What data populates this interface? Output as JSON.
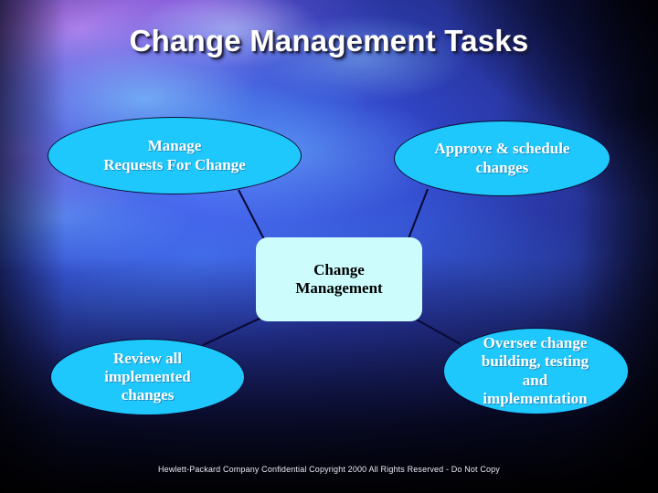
{
  "slide": {
    "title": "Change Management Tasks",
    "footer": "Hewlett-Packard Company Confidential Copyright 2000 All Rights Reserved - Do Not Copy",
    "background_colors": {
      "deep_navy": "#151a55",
      "purple": "#9660e2",
      "blue": "#3348cf",
      "cyan_glow": "#78cdff",
      "dark_edge": "#05030f"
    }
  },
  "diagram": {
    "type": "hub-and-spoke",
    "center": {
      "label": "Change\nManagement",
      "shape": "rounded-rectangle",
      "fill": "#ccfcfc",
      "text_color": "#000000"
    },
    "nodes": [
      {
        "id": "manage-requests",
        "label": "Manage\nRequests For Change",
        "shape": "ellipse",
        "fill": "#1ec8fc",
        "text_color": "#ffffff",
        "position": "top-left"
      },
      {
        "id": "approve-schedule",
        "label": "Approve & schedule\nchanges",
        "shape": "ellipse",
        "fill": "#1ec8fc",
        "text_color": "#ffffff",
        "position": "top-right"
      },
      {
        "id": "review-all",
        "label": "Review all\nimplemented\nchanges",
        "shape": "ellipse",
        "fill": "#1ec8fc",
        "text_color": "#ffffff",
        "position": "bottom-left"
      },
      {
        "id": "oversee-change",
        "label": "Oversee change\nbuilding, testing\nand\nimplementation",
        "shape": "ellipse",
        "fill": "#1ec8fc",
        "text_color": "#ffffff",
        "position": "bottom-right"
      }
    ],
    "connector_color": "#0a0a35",
    "connectors": [
      {
        "from": "manage-requests",
        "to": "center"
      },
      {
        "from": "approve-schedule",
        "to": "center"
      },
      {
        "from": "center",
        "to": "review-all"
      },
      {
        "from": "center",
        "to": "oversee-change"
      }
    ]
  }
}
